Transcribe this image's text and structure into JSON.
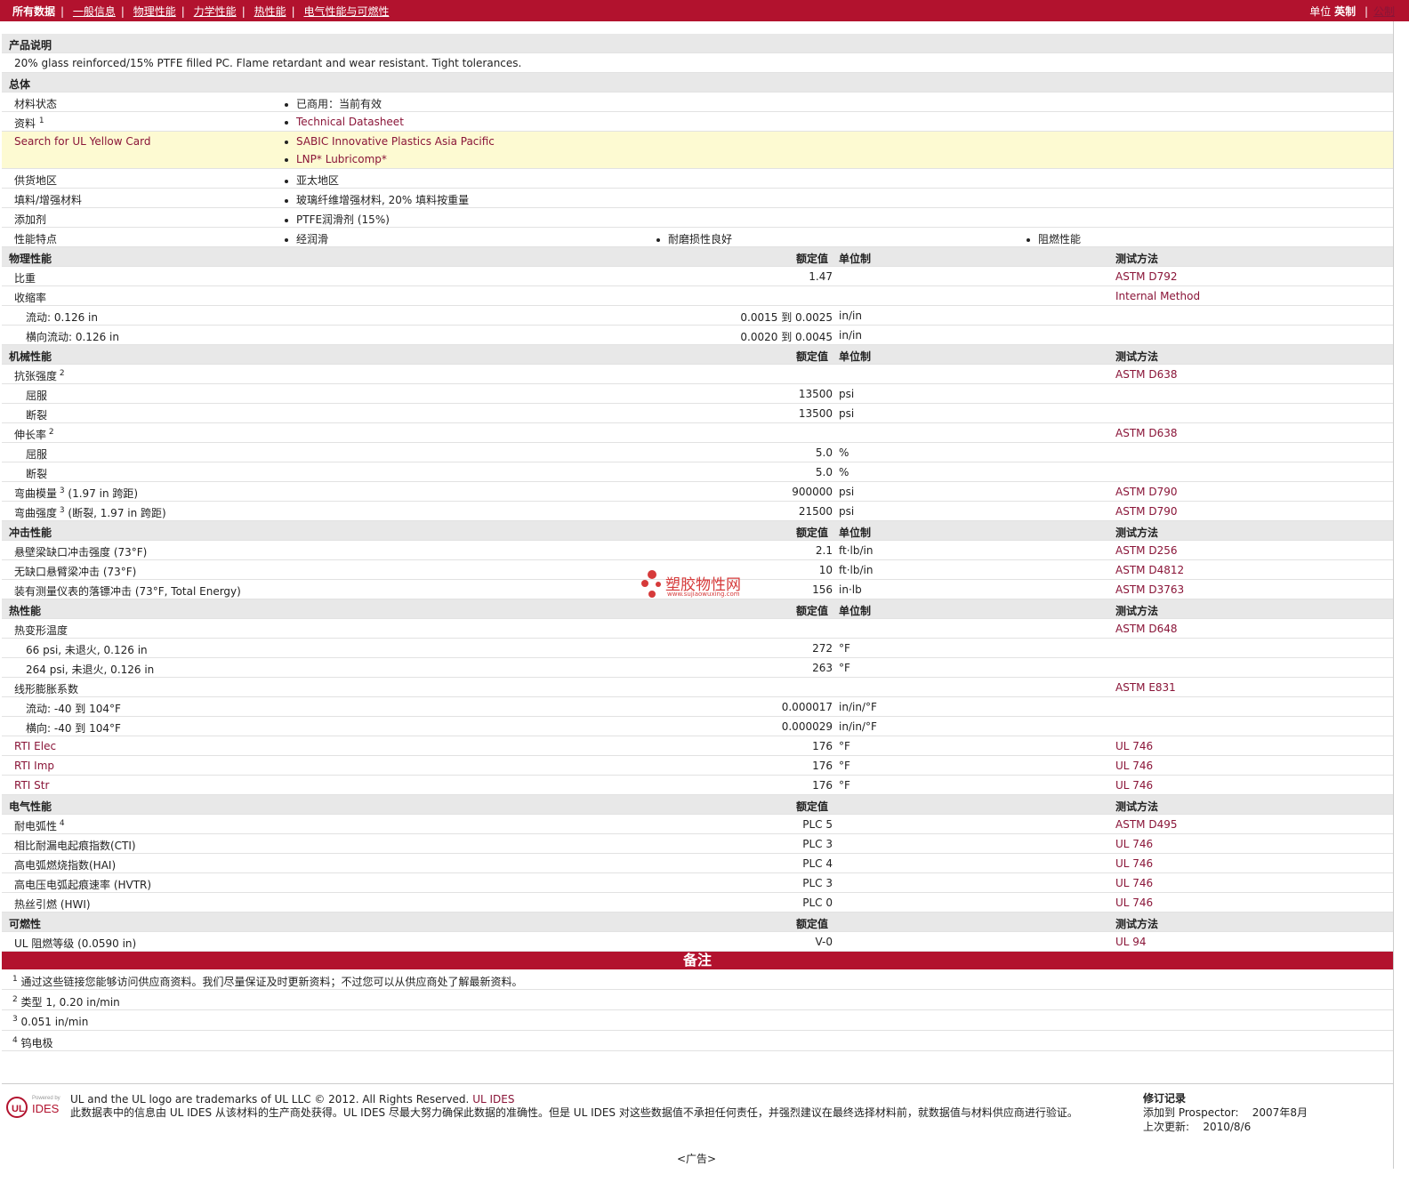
{
  "nav": {
    "items": [
      "所有数据",
      "一般信息",
      "物理性能",
      "力学性能",
      "热性能",
      "电气性能与可燃性"
    ],
    "units_label": "单位",
    "unit_selected": "英制",
    "unit_other": "公制"
  },
  "product": {
    "title": "产品说明",
    "description": "20% glass reinforced/15% PTFE filled PC. Flame retardant and wear resistant. Tight tolerances."
  },
  "general": {
    "title": "总体",
    "status_label": "材料状态",
    "status_value": "已商用：当前有效",
    "docs_label": "资料",
    "docs_sup": "1",
    "docs_value": "Technical Datasheet",
    "yellow_label": "Search for UL Yellow Card",
    "yellow_1": "SABIC Innovative Plastics Asia Pacific",
    "yellow_2": "LNP* Lubricomp*",
    "region_label": "供货地区",
    "region_value": "亚太地区",
    "filler_label": "填料/增强材料",
    "filler_value": "玻璃纤维增强材料, 20% 填料按重量",
    "additive_label": "添加剂",
    "additive_value": "PTFE润滑剂 (15%)",
    "features_label": "性能特点",
    "features": [
      "经润滑",
      "耐磨损性良好",
      "阻燃性能"
    ]
  },
  "headers": {
    "nominal": "额定值",
    "unit": "单位制",
    "method": "测试方法"
  },
  "physical": {
    "title": "物理性能",
    "rows": [
      {
        "label": "比重",
        "value": "1.47",
        "unit": "",
        "method": "ASTM D792",
        "indent": false,
        "sup": ""
      },
      {
        "label": "收缩率",
        "value": "",
        "unit": "",
        "method": "Internal Method",
        "indent": false,
        "sup": ""
      },
      {
        "label": "流动: 0.126 in",
        "value": "0.0015 到  0.0025",
        "unit": "in/in",
        "method": "",
        "indent": true,
        "sup": ""
      },
      {
        "label": "横向流动: 0.126 in",
        "value": "0.0020 到  0.0045",
        "unit": "in/in",
        "method": "",
        "indent": true,
        "sup": ""
      }
    ]
  },
  "mechanical": {
    "title": "机械性能",
    "rows": [
      {
        "label": "抗张强度",
        "sup": "2",
        "value": "",
        "unit": "",
        "method": "ASTM D638",
        "indent": false
      },
      {
        "label": "屈服",
        "sup": "",
        "value": "13500",
        "unit": "psi",
        "method": "",
        "indent": true
      },
      {
        "label": "断裂",
        "sup": "",
        "value": "13500",
        "unit": "psi",
        "method": "",
        "indent": true
      },
      {
        "label": "伸长率",
        "sup": "2",
        "value": "",
        "unit": "",
        "method": "ASTM D638",
        "indent": false
      },
      {
        "label": "屈服",
        "sup": "",
        "value": "5.0",
        "unit": "%",
        "method": "",
        "indent": true
      },
      {
        "label": "断裂",
        "sup": "",
        "value": "5.0",
        "unit": "%",
        "method": "",
        "indent": true
      },
      {
        "label": "弯曲模量",
        "sup": "3",
        "suffix": " (1.97 in 跨距)",
        "value": "900000",
        "unit": "psi",
        "method": "ASTM D790",
        "indent": false
      },
      {
        "label": "弯曲强度",
        "sup": "3",
        "suffix": " (断裂, 1.97 in 跨距)",
        "value": "21500",
        "unit": "psi",
        "method": "ASTM D790",
        "indent": false
      }
    ]
  },
  "impact": {
    "title": "冲击性能",
    "rows": [
      {
        "label": "悬壁梁缺口冲击强度 (73°F)",
        "value": "2.1",
        "unit": "ft·lb/in",
        "method": "ASTM D256"
      },
      {
        "label": "无缺口悬臂梁冲击 (73°F)",
        "value": "10",
        "unit": "ft·lb/in",
        "method": "ASTM D4812"
      },
      {
        "label": "装有测量仪表的落镖冲击 (73°F, Total Energy)",
        "value": "156",
        "unit": "in·lb",
        "method": "ASTM D3763"
      }
    ]
  },
  "thermal": {
    "title": "热性能",
    "rows": [
      {
        "label": "热变形温度",
        "value": "",
        "unit": "",
        "method": "ASTM D648",
        "indent": false
      },
      {
        "label": "66 psi, 未退火, 0.126 in",
        "value": "272",
        "unit": "°F",
        "method": "",
        "indent": true
      },
      {
        "label": "264 psi, 未退火, 0.126 in",
        "value": "263",
        "unit": "°F",
        "method": "",
        "indent": true
      },
      {
        "label": "线形膨胀系数",
        "value": "",
        "unit": "",
        "method": "ASTM E831",
        "indent": false
      },
      {
        "label": "流动: -40 到  104°F",
        "value": "0.000017",
        "unit": "in/in/°F",
        "method": "",
        "indent": true
      },
      {
        "label": "横向: -40 到  104°F",
        "value": "0.000029",
        "unit": "in/in/°F",
        "method": "",
        "indent": true
      },
      {
        "label": "RTI Elec",
        "value": "176",
        "unit": "°F",
        "method": "UL 746",
        "indent": false,
        "link": true
      },
      {
        "label": "RTI Imp",
        "value": "176",
        "unit": "°F",
        "method": "UL 746",
        "indent": false,
        "link": true
      },
      {
        "label": "RTI Str",
        "value": "176",
        "unit": "°F",
        "method": "UL 746",
        "indent": false,
        "link": true
      }
    ]
  },
  "electrical": {
    "title": "电气性能",
    "rows": [
      {
        "label": "耐电弧性",
        "sup": "4",
        "value": "PLC 5",
        "method": "ASTM D495"
      },
      {
        "label": "相比耐漏电起痕指数(CTI)",
        "sup": "",
        "value": "PLC 3",
        "method": "UL 746"
      },
      {
        "label": "高电弧燃烧指数(HAI)",
        "sup": "",
        "value": "PLC 4",
        "method": "UL 746"
      },
      {
        "label": "高电压电弧起痕速率 (HVTR)",
        "sup": "",
        "value": "PLC 3",
        "method": "UL 746"
      },
      {
        "label": "热丝引燃 (HWI)",
        "sup": "",
        "value": "PLC 0",
        "method": "UL 746"
      }
    ]
  },
  "flammability": {
    "title": "可燃性",
    "rows": [
      {
        "label": "UL 阻燃等级 (0.0590 in)",
        "value": "V-0",
        "method": "UL 94"
      }
    ]
  },
  "notes": {
    "title": "备注",
    "items": [
      {
        "n": "1",
        "text": "通过这些链接您能够访问供应商资料。我们尽量保证及时更新资料；不过您可以从供应商处了解最新资料。"
      },
      {
        "n": "2",
        "text": "类型  1, 0.20 in/min"
      },
      {
        "n": "3",
        "text": "0.051 in/min"
      },
      {
        "n": "4",
        "text": "钨电极"
      }
    ]
  },
  "footer": {
    "logo_powered": "Powered by",
    "logo_ul": "UL",
    "logo_ides": "IDES",
    "line1": "UL and the UL logo are trademarks of UL LLC © 2012. All Rights Reserved.",
    "line1_link": "UL IDES",
    "line2": "此数据表中的信息由  UL IDES 从该材料的生产商处获得。UL IDES 尽最大努力确保此数据的准确性。但是  UL IDES 对这些数据值不承担任何责任，并强烈建议在最终选择材料前，就数据值与材料供应商进行验证。",
    "rev_title": "修订记录",
    "rev_added_label": "添加到  Prospector:",
    "rev_added_value": "2007年8月",
    "rev_updated_label": "上次更新:",
    "rev_updated_value": "2010/8/6",
    "ad": "<广告>"
  },
  "watermark": {
    "text": "塑胶物性网",
    "url": "www.sujiaowuxing.com"
  },
  "colors": {
    "brand_red": "#b2122e",
    "link": "#8a1538",
    "section_bg": "#e8e8e8",
    "yellow_bg": "#fdfad2"
  }
}
